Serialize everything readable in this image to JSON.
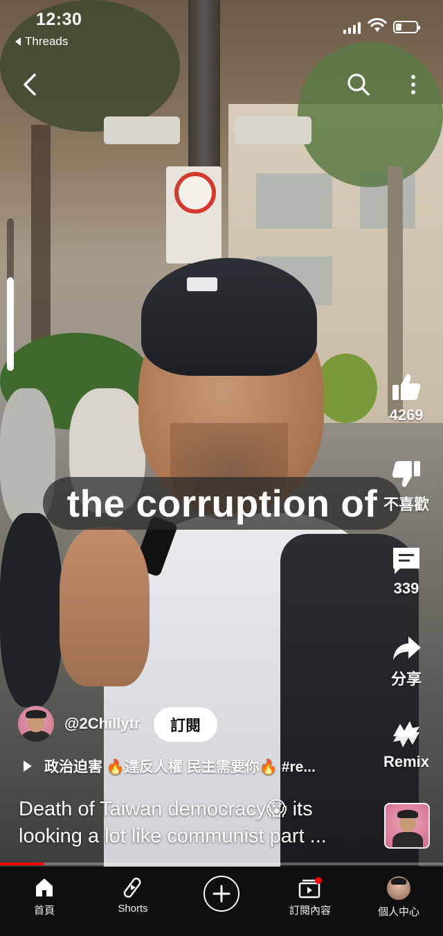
{
  "status_bar": {
    "time": "12:30",
    "back_app": "Threads",
    "signal": "signal-icon",
    "wifi": "wifi-icon",
    "battery_level": 0.3
  },
  "top_bar": {
    "back_icon": "chevron-left-icon",
    "search_icon": "search-icon",
    "more_icon": "more-vertical-icon"
  },
  "video": {
    "caption": "the corruption of",
    "progress": 0.1
  },
  "actions": {
    "like_count": "4269",
    "dislike_label": "不喜歡",
    "comment_count": "339",
    "share_label": "分享",
    "remix_label": "Remix"
  },
  "channel": {
    "name": "@2Chillytr",
    "subscribe_label": "訂閱"
  },
  "music": {
    "text": "政治迫害 🔥違反人權 民主需要你🔥 #re..."
  },
  "title": {
    "line1": "Death of Taiwan democracy😱  its",
    "line2": "looking a lot like communist part ..."
  },
  "nav": {
    "items": [
      {
        "label": "首頁",
        "icon": "home-icon"
      },
      {
        "label": "Shorts",
        "icon": "shorts-icon"
      },
      {
        "label": "",
        "icon": "create-plus-icon"
      },
      {
        "label": "訂閱內容",
        "icon": "subscriptions-icon"
      },
      {
        "label": "個人中心",
        "icon": "profile-avatar-icon"
      }
    ]
  },
  "colors": {
    "progress_fill": "#ff0000",
    "nav_background": "#0f0f0f",
    "notification_dot": "#ff0000"
  }
}
